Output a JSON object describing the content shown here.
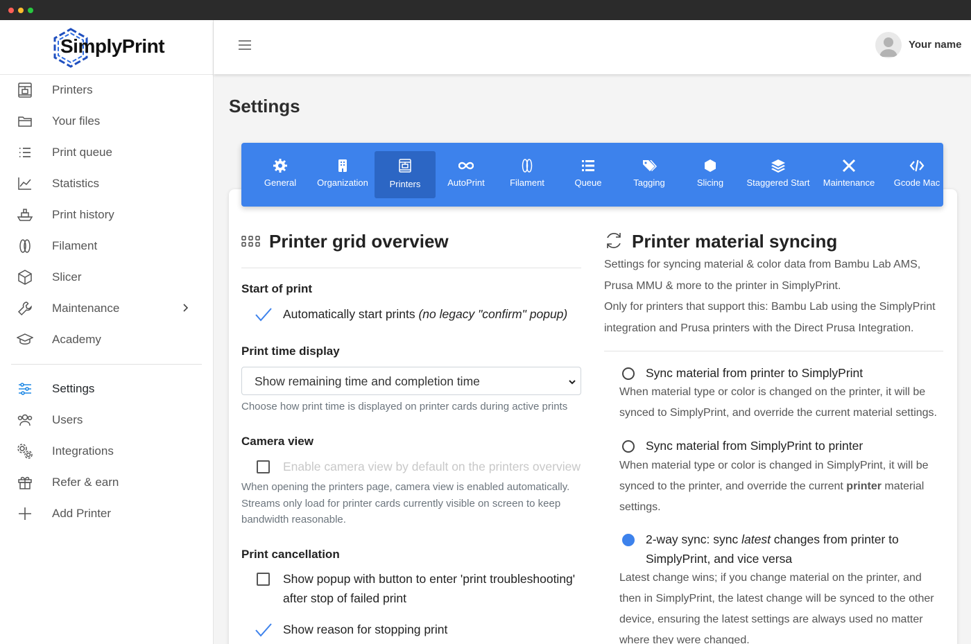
{
  "window": {
    "dots": [
      "#ff5f57",
      "#febc2e",
      "#28c840"
    ]
  },
  "brand": {
    "name": "SimplyPrint",
    "accent": "#3d82ec",
    "logo_ring": "#1f4fbf"
  },
  "sidebar": {
    "items": [
      {
        "id": "printers",
        "label": "Printers",
        "icon": "printer-icon"
      },
      {
        "id": "files",
        "label": "Your files",
        "icon": "folder-icon"
      },
      {
        "id": "queue",
        "label": "Print queue",
        "icon": "list-icon"
      },
      {
        "id": "statistics",
        "label": "Statistics",
        "icon": "chart-icon"
      },
      {
        "id": "history",
        "label": "Print history",
        "icon": "ship-icon"
      },
      {
        "id": "filament",
        "label": "Filament",
        "icon": "filament-icon"
      },
      {
        "id": "slicer",
        "label": "Slicer",
        "icon": "cube-icon"
      },
      {
        "id": "maintenance",
        "label": "Maintenance",
        "icon": "wrench-icon"
      },
      {
        "id": "academy",
        "label": "Academy",
        "icon": "graduation-cap-icon"
      },
      {
        "id": "settings",
        "label": "Settings",
        "icon": "sliders-icon",
        "active": true
      },
      {
        "id": "users",
        "label": "Users",
        "icon": "users-icon"
      },
      {
        "id": "integrations",
        "label": "Integrations",
        "icon": "gears-icon"
      },
      {
        "id": "refer",
        "label": "Refer & earn",
        "icon": "gift-icon"
      },
      {
        "id": "add-printer",
        "label": "Add Printer",
        "icon": "plus-icon"
      }
    ]
  },
  "header": {
    "user_name": "Your name"
  },
  "page": {
    "title": "Settings"
  },
  "tabs": [
    {
      "label": "General",
      "icon": "gear-icon"
    },
    {
      "label": "Organization",
      "icon": "building-icon"
    },
    {
      "label": "Printers",
      "icon": "printer-icon",
      "active": true
    },
    {
      "label": "AutoPrint",
      "icon": "infinity-icon"
    },
    {
      "label": "Filament",
      "icon": "filament-icon"
    },
    {
      "label": "Queue",
      "icon": "list-icon"
    },
    {
      "label": "Tagging",
      "icon": "tags-icon"
    },
    {
      "label": "Slicing",
      "icon": "cube-icon"
    },
    {
      "label": "Staggered Start",
      "icon": "layers-icon"
    },
    {
      "label": "Maintenance",
      "icon": "tools-icon"
    },
    {
      "label": "Gcode Mac",
      "icon": "code-icon"
    }
  ],
  "grid_overview": {
    "title": "Printer grid overview",
    "start_of_print": {
      "label": "Start of print",
      "option_text": "Automatically start prints ",
      "option_em": "(no legacy \"confirm\" popup)"
    },
    "print_time": {
      "label": "Print time display",
      "selected": "Show remaining time and completion time",
      "help": "Choose how print time is displayed on printer cards during active prints"
    },
    "camera": {
      "label": "Camera view",
      "option": "Enable camera view by default on the printers overview",
      "help": "When opening the printers page, camera view is enabled automatically. Streams only load for printer cards currently visible on screen to keep bandwidth reasonable."
    },
    "cancellation": {
      "label": "Print cancellation",
      "option1": "Show popup with button to enter 'print troubleshooting' after stop of failed print",
      "option2": "Show reason for stopping print"
    }
  },
  "material_sync": {
    "title": "Printer material syncing",
    "desc1": "Settings for syncing material & color data from Bambu Lab AMS, Prusa MMU & more to the printer in SimplyPrint.",
    "desc2": "Only for printers that support this: Bambu Lab using the SimplyPrint integration and Prusa printers with the Direct Prusa Integration.",
    "option1": {
      "label": "Sync material from printer to SimplyPrint",
      "desc": "When material type or color is changed on the printer, it will be synced to SimplyPrint, and override the current material settings."
    },
    "option2": {
      "label": "Sync material from SimplyPrint to printer",
      "desc_pre": "When material type or color is changed in SimplyPrint, it will be synced to the printer, and override the current ",
      "desc_bold": "printer",
      "desc_post": " material settings."
    },
    "option3": {
      "label_pre": "2-way sync: sync ",
      "label_em": "latest",
      "label_post": " changes from printer to SimplyPrint, and vice versa",
      "desc": "Latest change wins; if you change material on the printer, and then in SimplyPrint, the latest change will be synced to the other device, ensuring the latest settings are always used no matter where they were changed."
    }
  }
}
